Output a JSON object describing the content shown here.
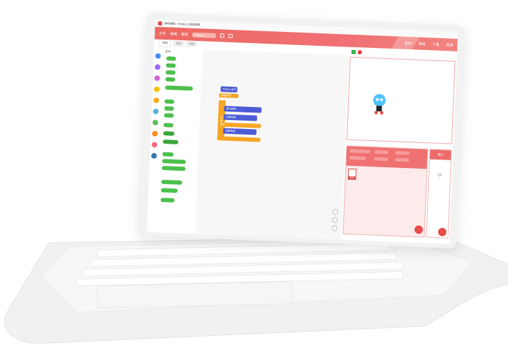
{
  "titlebar": {
    "title": "源码编程 - (Python) 高级模板"
  },
  "menubar": {
    "items": [
      "文件",
      "编辑",
      "教程"
    ],
    "project_name": "Untitled",
    "right_items": [
      "素材",
      "教程",
      "下载",
      "登录"
    ]
  },
  "tabs": {
    "blocks": "代码",
    "costumes": "造型",
    "sounds": "声音"
  },
  "palette": {
    "section_label": "运动"
  },
  "code": {
    "hat": "Python 运行",
    "comment": "重复执行",
    "if_label": "如果",
    "block1": "面向鼠标",
    "block2": "设置角度",
    "block3": "设置角度",
    "else_label": "否则"
  },
  "stage_panel": {
    "sprite_label": "角色",
    "background_label": "舞台",
    "bg_count": "背景",
    "bg_num": "1"
  },
  "colors": {
    "accent": "#ef6b6b",
    "block_blue": "#4c5bd6",
    "block_orange": "#f5a623",
    "block_green": "#4cc04c"
  }
}
